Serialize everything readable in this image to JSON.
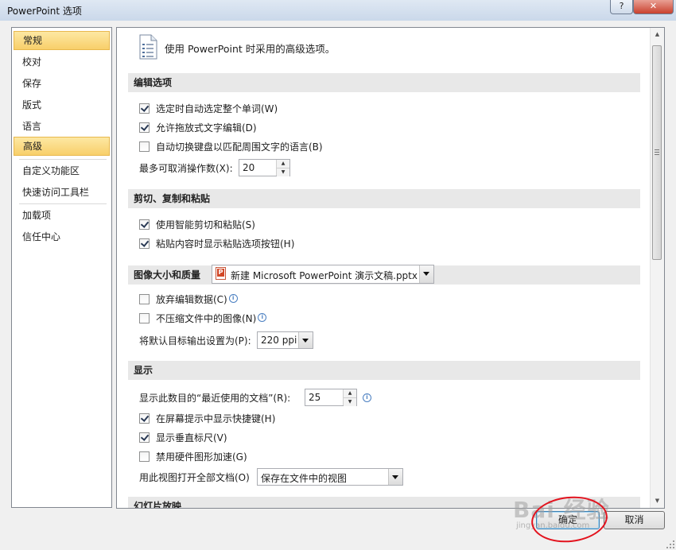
{
  "window": {
    "title": "PowerPoint 选项",
    "help_glyph": "?",
    "close_glyph": "✕"
  },
  "nav": {
    "items": [
      {
        "label": "常规",
        "selected": true
      },
      {
        "label": "校对",
        "selected": false
      },
      {
        "label": "保存",
        "selected": false
      },
      {
        "label": "版式",
        "selected": false
      },
      {
        "label": "语言",
        "selected": false
      },
      {
        "label": "高级",
        "selected": true
      },
      {
        "label": "自定义功能区",
        "selected": false
      },
      {
        "label": "快速访问工具栏",
        "selected": false
      },
      {
        "label": "加载项",
        "selected": false
      },
      {
        "label": "信任中心",
        "selected": false
      }
    ]
  },
  "content": {
    "header": "使用 PowerPoint 时采用的高级选项。",
    "sections": {
      "editing": {
        "title": "编辑选项",
        "options": [
          {
            "label": "选定时自动选定整个单词(W)",
            "checked": true
          },
          {
            "label": "允许拖放式文字编辑(D)",
            "checked": true
          },
          {
            "label": "自动切换键盘以匹配周围文字的语言(B)",
            "checked": false
          }
        ],
        "undo_label": "最多可取消操作数(X):",
        "undo_value": "20"
      },
      "clipboard": {
        "title": "剪切、复制和粘贴",
        "options": [
          {
            "label": "使用智能剪切和粘贴(S)",
            "checked": true
          },
          {
            "label": "粘贴内容时显示粘贴选项按钮(H)",
            "checked": true
          }
        ]
      },
      "image": {
        "title": "图像大小和质量",
        "file_select": "新建 Microsoft PowerPoint 演示文稿.pptx",
        "options": [
          {
            "label": "放弃编辑数据(C)",
            "checked": false
          },
          {
            "label": "不压缩文件中的图像(N)",
            "checked": false
          }
        ],
        "output_label": "将默认目标输出设置为(P):",
        "output_value": "220 ppi"
      },
      "display": {
        "title": "显示",
        "recent_label": "显示此数目的“最近使用的文档”(R):",
        "recent_value": "25",
        "options": [
          {
            "label": "在屏幕提示中显示快捷键(H)",
            "checked": true
          },
          {
            "label": "显示垂直标尺(V)",
            "checked": true
          },
          {
            "label": "禁用硬件图形加速(G)",
            "checked": false
          }
        ],
        "view_label": "用此视图打开全部文档(O)",
        "view_value": "保存在文件中的视图"
      },
      "slideshow": {
        "title": "幻灯片放映"
      }
    }
  },
  "buttons": {
    "ok": "确定",
    "cancel": "取消"
  },
  "watermark": {
    "text": "Bai 经验",
    "sub": "jingyan.baidu.com"
  },
  "colors": {
    "nav_selected": "#f8cf6a",
    "annotation": "#e3131e",
    "section_bg": "#e8e8e8"
  }
}
